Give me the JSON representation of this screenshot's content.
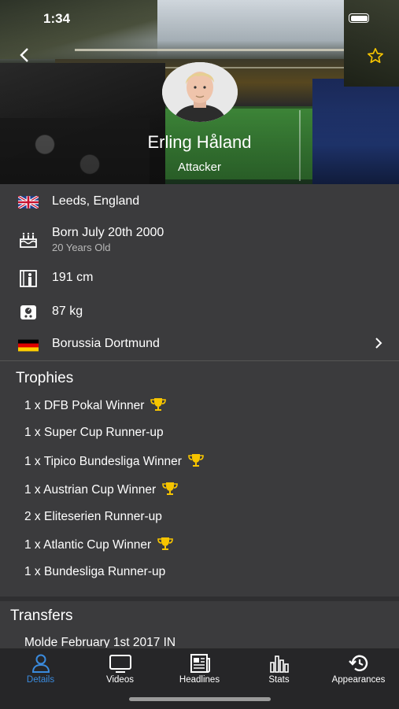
{
  "status": {
    "time": "1:34"
  },
  "header": {
    "player_name": "Erling Håland",
    "position": "Attacker"
  },
  "details": {
    "birthplace": "Leeds, England",
    "born": "Born July 20th 2000",
    "age": "20 Years Old",
    "height": "191 cm",
    "weight": "87 kg",
    "club": "Borussia Dortmund"
  },
  "trophies": {
    "title": "Trophies",
    "items": [
      {
        "label": "1 x DFB Pokal Winner",
        "winner": true
      },
      {
        "label": "1 x Super Cup Runner-up",
        "winner": false
      },
      {
        "label": "1 x Tipico Bundesliga Winner",
        "winner": true
      },
      {
        "label": "1 x Austrian Cup Winner",
        "winner": true
      },
      {
        "label": "2 x Eliteserien Runner-up",
        "winner": false
      },
      {
        "label": "1 x Atlantic Cup Winner",
        "winner": true
      },
      {
        "label": "1 x Bundesliga Runner-up",
        "winner": false
      }
    ]
  },
  "transfers": {
    "title": "Transfers",
    "first": "Molde February 1st 2017 IN"
  },
  "tabs": [
    {
      "label": "Details",
      "icon": "person-icon",
      "active": true
    },
    {
      "label": "Videos",
      "icon": "tv-icon",
      "active": false
    },
    {
      "label": "Headlines",
      "icon": "newspaper-icon",
      "active": false
    },
    {
      "label": "Stats",
      "icon": "bar-chart-icon",
      "active": false
    },
    {
      "label": "Appearances",
      "icon": "history-icon",
      "active": false
    }
  ],
  "colors": {
    "accent": "#3a8bde",
    "trophy": "#f6c400",
    "background": "#3b3b3d",
    "tabbar": "#262628"
  }
}
